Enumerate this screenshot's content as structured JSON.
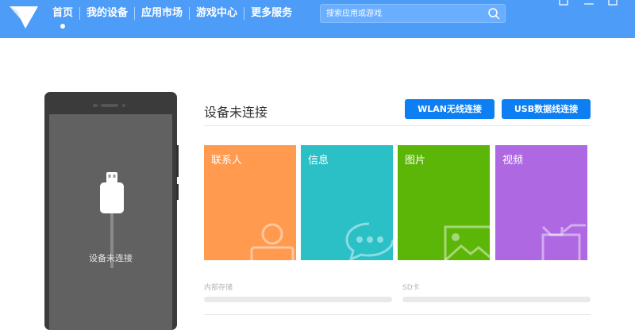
{
  "nav": {
    "items": [
      {
        "label": "首页",
        "active": true
      },
      {
        "label": "我的设备",
        "active": false
      },
      {
        "label": "应用市场",
        "active": false
      },
      {
        "label": "游戏中心",
        "active": false
      },
      {
        "label": "更多服务",
        "active": false
      }
    ]
  },
  "search": {
    "placeholder": "搜索应用或游戏",
    "icon": "search-icon"
  },
  "colors": {
    "topbar": "#4d9df8",
    "button": "#0d7ff3",
    "contacts": "#ff9a4f",
    "messages": "#2bc0c6",
    "photos": "#5cb607",
    "videos": "#ad68e2"
  },
  "phone": {
    "status": "设备未连接"
  },
  "main": {
    "status_title": "设备未连接",
    "wlan_button": "WLAN无线连接",
    "usb_button": "USB数据线连接"
  },
  "tiles": [
    {
      "label": "联系人",
      "icon": "contact-icon"
    },
    {
      "label": "信息",
      "icon": "message-icon"
    },
    {
      "label": "图片",
      "icon": "picture-icon"
    },
    {
      "label": "视频",
      "icon": "video-icon"
    }
  ],
  "storage": {
    "internal_label": "内部存储",
    "internal_used_fraction": 0,
    "sd_label": "SD卡",
    "sd_used_fraction": 0
  }
}
